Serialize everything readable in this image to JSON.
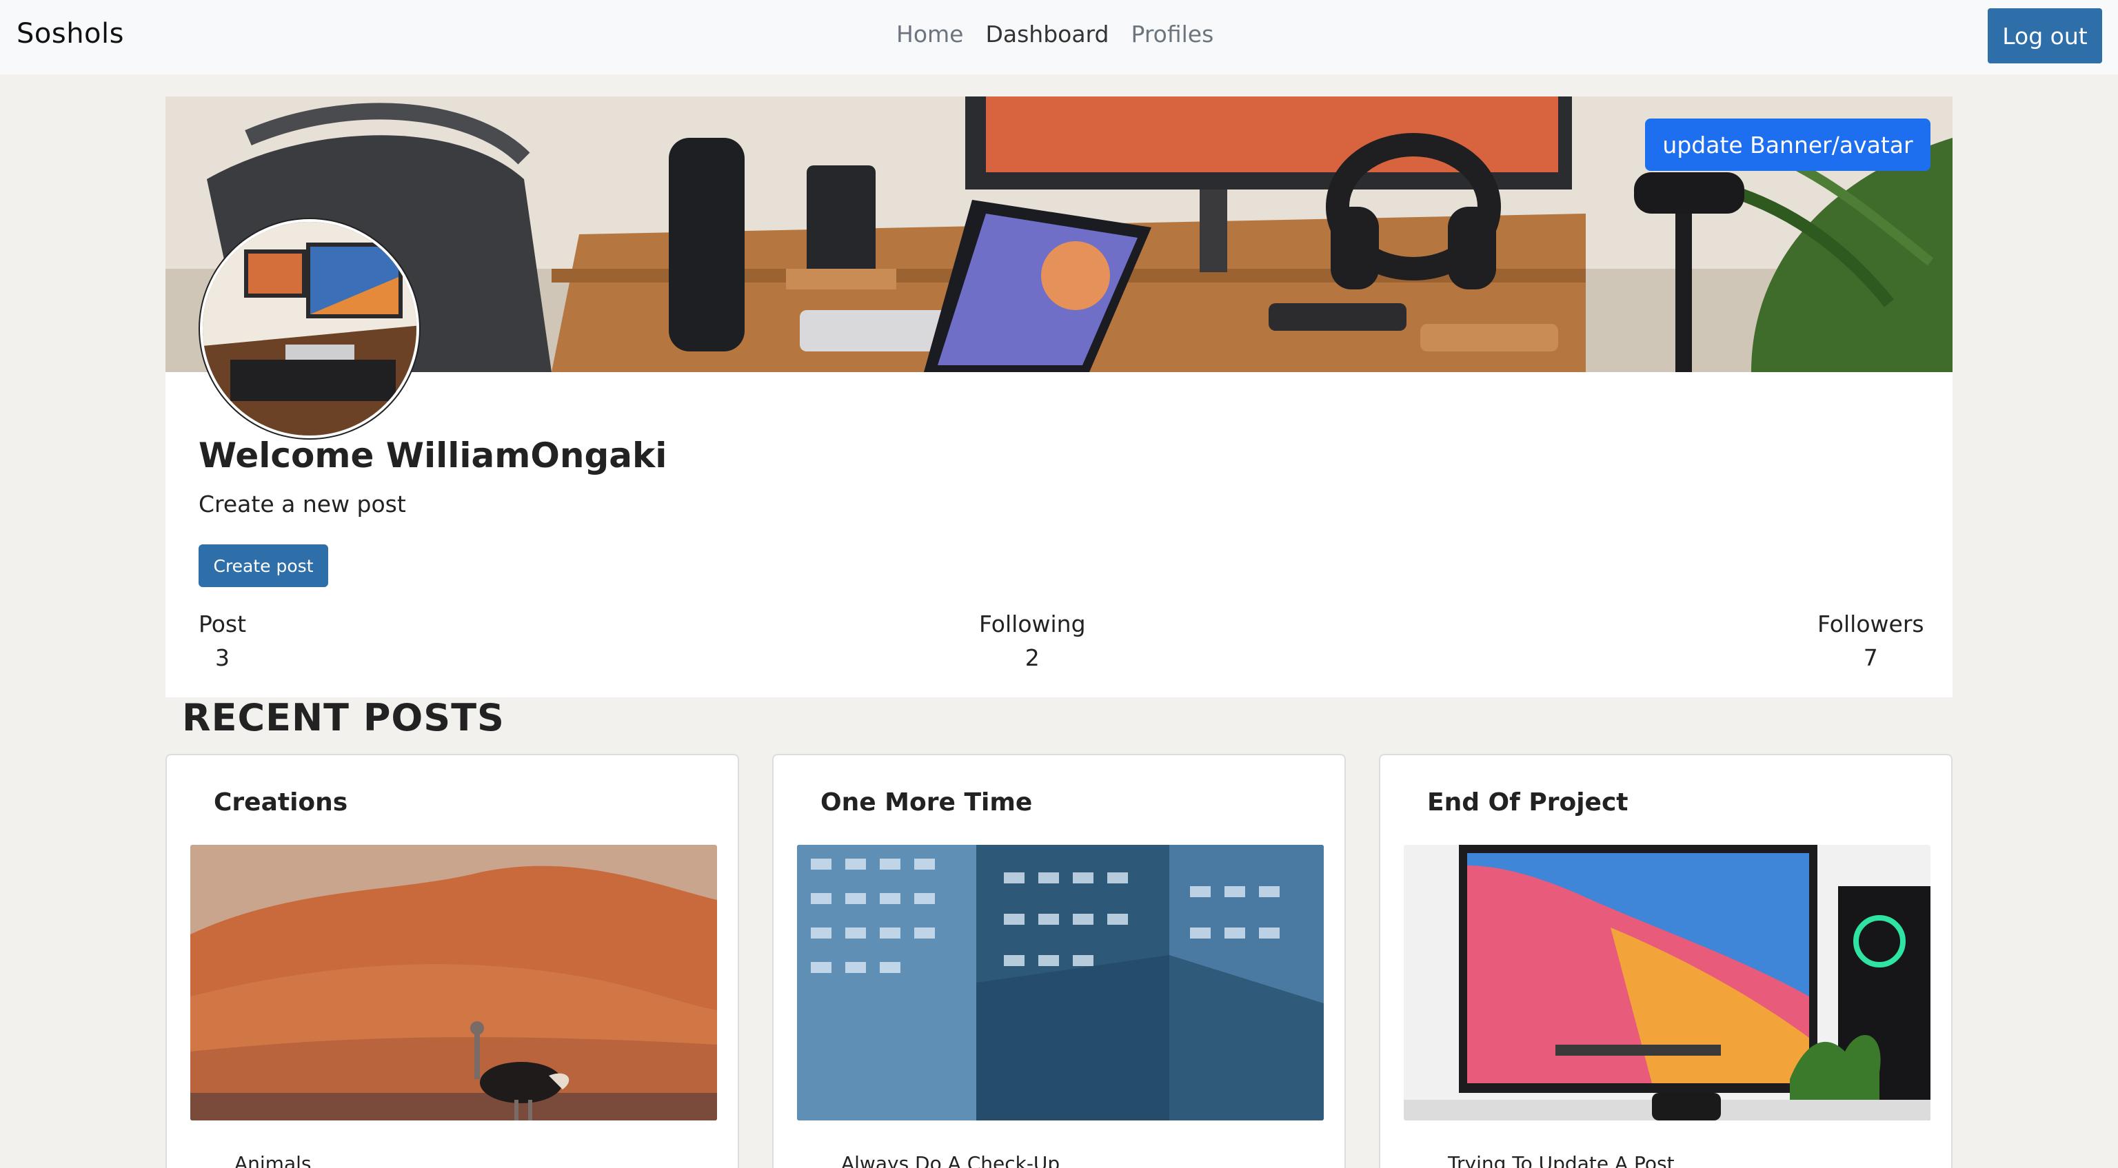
{
  "navbar": {
    "brand": "Soshols",
    "links": [
      "Home",
      "Dashboard",
      "Profiles"
    ],
    "active": "Dashboard",
    "logout_label": "Log out"
  },
  "profile": {
    "banner_button_label": "update Banner/avatar",
    "welcome": "Welcome WilliamOngaki",
    "subtitle": "Create a new post",
    "create_post_label": "Create post",
    "stats": [
      {
        "label": "Post",
        "value": "3"
      },
      {
        "label": "Following",
        "value": "2"
      },
      {
        "label": "Followers",
        "value": "7"
      }
    ]
  },
  "recent_posts": {
    "heading": "RECENT POSTS",
    "items": [
      {
        "title": "Creations",
        "caption": "Animals",
        "image": "desert-ostrich"
      },
      {
        "title": "One More Time",
        "caption": "Always Do A Check-Up",
        "image": "office-building-night"
      },
      {
        "title": "End Of Project",
        "caption": "Trying To Update A Post",
        "image": "monitor-desk-setup"
      }
    ]
  },
  "colors": {
    "primary": "#2f6fa9",
    "banner_button": "#1d6ff0",
    "page_background": "#f2f1ee",
    "navbar_background": "#f8f9fa"
  }
}
